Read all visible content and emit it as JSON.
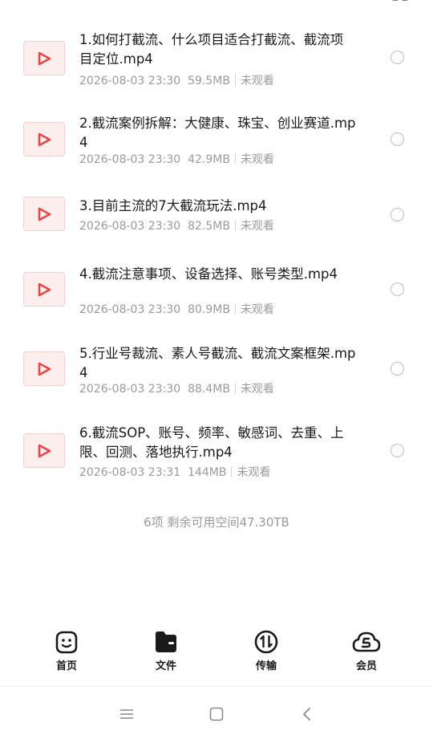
{
  "files": [
    {
      "title": "1.如何打截流、什么项目适合打截流、截流项目定位.mp4",
      "date": "2026-08-03 23:30",
      "size": "59.5MB",
      "status": "未观看"
    },
    {
      "title": "2.截流案例拆解：大健康、珠宝、创业赛道.mp4",
      "date": "2026-08-03 23:30",
      "size": "42.9MB",
      "status": "未观看"
    },
    {
      "title": "3.目前主流的7大截流玩法.mp4",
      "date": "2026-08-03 23:30",
      "size": "82.5MB",
      "status": "未观看"
    },
    {
      "title": "4.截流注意事项、设备选择、账号类型.mp4",
      "date": "2026-08-03 23:30",
      "size": "80.9MB",
      "status": "未观看"
    },
    {
      "title": "5.行业号裁流、素人号截流、截流文案框架.mp4",
      "date": "2026-08-03 23:30",
      "size": "88.4MB",
      "status": "未观看"
    },
    {
      "title": "6.截流SOP、账号、频率、敏感词、去重、上限、回测、落地执行.mp4",
      "date": "2026-08-03 23:31",
      "size": "144MB",
      "status": "未观看"
    }
  ],
  "footer": {
    "summary": "6项 剩余可用空间47.30TB"
  },
  "tabs": [
    {
      "label": "首页",
      "icon": "smile-face-icon"
    },
    {
      "label": "文件",
      "icon": "folder-icon"
    },
    {
      "label": "传输",
      "icon": "transfer-icon"
    },
    {
      "label": "会员",
      "icon": "cloud-vip-icon"
    }
  ],
  "system_nav": [
    "menu-icon",
    "home-square-icon",
    "back-icon"
  ],
  "colors": {
    "accent_red": "#e8474a",
    "text": "#1a1a1a",
    "muted": "#9a9a9a"
  }
}
